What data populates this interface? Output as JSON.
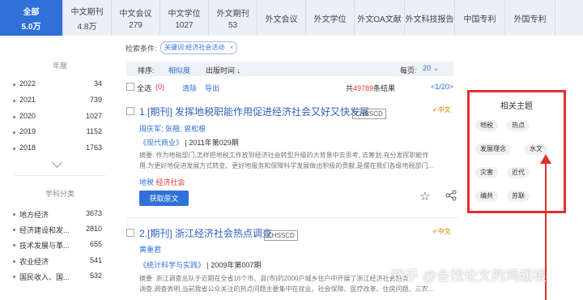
{
  "tabs": [
    {
      "label": "全部",
      "count": "5.0万"
    },
    {
      "label": "中文期刊",
      "count": "4.8万"
    },
    {
      "label": "中文会议",
      "count": "279"
    },
    {
      "label": "中文学位",
      "count": "1027"
    },
    {
      "label": "外文期刊",
      "count": "53"
    },
    {
      "label": "外文会议",
      "count": ""
    },
    {
      "label": "外文学位",
      "count": ""
    },
    {
      "label": "外文OA文献",
      "count": ""
    },
    {
      "label": "外文科技报告",
      "count": ""
    },
    {
      "label": "中国专利",
      "count": ""
    },
    {
      "label": "外国专利",
      "count": ""
    }
  ],
  "sidebar": {
    "year_title": "年度",
    "years": [
      {
        "label": "2022",
        "count": "34"
      },
      {
        "label": "2021",
        "count": "739"
      },
      {
        "label": "2020",
        "count": "1027"
      },
      {
        "label": "2019",
        "count": "1152"
      },
      {
        "label": "2018",
        "count": "1763"
      }
    ],
    "subject_title": "学科分类",
    "subjects": [
      {
        "label": "地方经济",
        "count": "3673"
      },
      {
        "label": "经济建设和发...",
        "count": "2810"
      },
      {
        "label": "技术发展与革...",
        "count": "655"
      },
      {
        "label": "农业经济",
        "count": "541"
      },
      {
        "label": "国民收入、国...",
        "count": "532"
      }
    ]
  },
  "search": {
    "label": "检索条件:",
    "tag": "关键词:经济社会活动"
  },
  "sort": {
    "label": "排序:",
    "relevance": "相似度",
    "time": "出版时间 ↓",
    "per_page_label": "每页:",
    "per_page": "20"
  },
  "toolbar": {
    "select_all": "全选",
    "selected": "(0)",
    "clear": "清除",
    "export": "导出",
    "total_prefix": "共",
    "total": "49789",
    "total_suffix": "条结果",
    "pager": "<1/20>"
  },
  "results": [
    {
      "title": "1.[期刊] 发挥地税职能作用促进经济社会又好又快发展",
      "badge": "CHSSCD",
      "lang": "中文",
      "author1": "周庆军",
      "author2": "张翘",
      "author3": "曾松根",
      "source": "《现代商业》",
      "issue": "| 2011年第029期",
      "abstract1": "摘要: 作为地税部门,怎样把地税工作放到经济社会转型升级的大背景中去思考, 去筹划,充分发挥职能作",
      "abstract2": "用,为更好地促进发展方式转变、更好地服务和保障科学发展做出积极的贡献,是摆在我们各级地税部门...",
      "kw1": "地税",
      "kw2": "经济社会",
      "fetch": "获取原文"
    },
    {
      "title": "2.[期刊] 浙江经济社会热点调查",
      "badge": "CHSSCD",
      "lang": "中文",
      "author1": "黄重君",
      "source": "《统计科学与实践》",
      "issue": "| 2009年第007期",
      "abstract1": "摘要: 浙江调查总队于近期在全省16个市、县(市)的2000户城乡住户中开展了浙江经济社会热点",
      "abstract2": "调查,调查表明,当前我省公众关注的热点问题主要集中在就业、社会保障、医疗改革、住房问题、三农..."
    }
  ],
  "related": {
    "title": "相关主题",
    "topics": [
      "地税",
      "热点",
      "发展理念",
      "水文",
      "灾害",
      "近代",
      "编共",
      "苏联"
    ]
  },
  "watermark": "知乎 @会找论文的鸡翅根",
  "colors": {
    "accent": "#2f71d8",
    "highlight_border": "#e03030",
    "keyword_red": "#e33"
  }
}
